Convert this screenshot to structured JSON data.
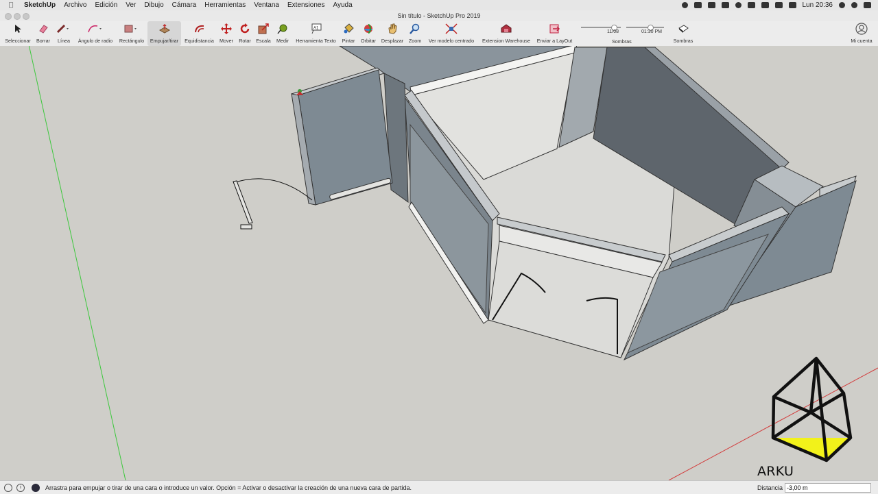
{
  "menubar": {
    "app_name": "SketchUp",
    "items": [
      "Archivo",
      "Edición",
      "Ver",
      "Dibujo",
      "Cámara",
      "Herramientas",
      "Ventana",
      "Extensiones",
      "Ayuda"
    ],
    "clock": "Lun 20:36"
  },
  "window": {
    "title": "Sin título - SketchUp Pro 2019"
  },
  "toolbar": {
    "tools": [
      {
        "label": "Seleccionar",
        "icon": "select-arrow-icon"
      },
      {
        "label": "Borrar",
        "icon": "eraser-icon"
      },
      {
        "label": "Línea",
        "icon": "pencil-line-icon"
      },
      {
        "label": "Ángulo de radio",
        "icon": "arc-icon"
      },
      {
        "label": "Rectángulo",
        "icon": "rectangle-icon"
      },
      {
        "label": "Empujar/tirar",
        "icon": "push-pull-icon"
      },
      {
        "label": "Equidistancia",
        "icon": "offset-icon"
      },
      {
        "label": "Mover",
        "icon": "move-icon"
      },
      {
        "label": "Rotar",
        "icon": "rotate-icon"
      },
      {
        "label": "Escala",
        "icon": "scale-icon"
      },
      {
        "label": "Medir",
        "icon": "tape-measure-icon"
      },
      {
        "label": "Herramienta Texto",
        "icon": "text-tool-icon"
      },
      {
        "label": "Pintar",
        "icon": "paint-bucket-icon"
      },
      {
        "label": "Orbitar",
        "icon": "orbit-icon"
      },
      {
        "label": "Desplazar",
        "icon": "pan-hand-icon"
      },
      {
        "label": "Zoom",
        "icon": "zoom-icon"
      },
      {
        "label": "Ver modelo centrado",
        "icon": "zoom-extents-icon"
      },
      {
        "label": "Extension Warehouse",
        "icon": "extension-warehouse-icon"
      },
      {
        "label": "Enviar a LayOut",
        "icon": "send-to-layout-icon"
      }
    ],
    "shadow_date": "11/08",
    "shadow_time": "01:30 PM",
    "shadow_label": "Sombras",
    "shadow_toggle_label": "Sombras",
    "account_label": "Mi cuenta",
    "text_tool_badge": "A1"
  },
  "statusbar": {
    "hint": "Arrastra para empujar o tirar de una cara o introduce un valor. Opción = Activar o desactivar la creación de una nueva cara de partida.",
    "measurement_label": "Distancia",
    "measurement_value": "-3,00 m"
  },
  "watermark": {
    "text": "ARKU ARQUITECTURA"
  },
  "colors": {
    "viewport_bg": "#cfcec9",
    "wall_face": "#7e8a93",
    "wall_dark": "#5c6269",
    "floor": "#d9d9d6",
    "axis_green": "#3cc83c",
    "axis_red": "#d23c3c",
    "logo_yellow": "#f2f21a"
  }
}
